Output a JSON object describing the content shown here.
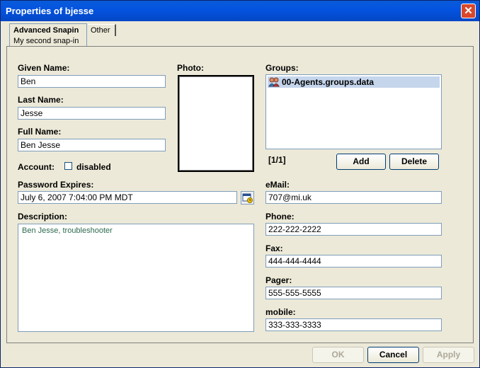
{
  "window": {
    "title": "Properties of bjesse",
    "close_glyph": "✕"
  },
  "tabs": [
    {
      "label": "Advanced Snapin",
      "sublabel": "My second snap-in"
    },
    {
      "label": "Other"
    }
  ],
  "form": {
    "given_name": {
      "label": "Given Name:",
      "value": "Ben"
    },
    "last_name": {
      "label": "Last Name:",
      "value": "Jesse"
    },
    "full_name": {
      "label": "Full Name:",
      "value": "Ben Jesse"
    },
    "account": {
      "label": "Account:",
      "checkbox_label": "disabled",
      "checked": false
    },
    "password_expires": {
      "label": "Password Expires:",
      "value": "July 6, 2007 7:04:00 PM MDT"
    },
    "description": {
      "label": "Description:",
      "value": "Ben Jesse, troubleshooter"
    },
    "photo": {
      "label": "Photo:"
    },
    "groups": {
      "label": "Groups:",
      "items": [
        "00-Agents.groups.data"
      ],
      "counter": "[1/1]"
    },
    "email": {
      "label": "eMail:",
      "value": "707@mi.uk"
    },
    "phone": {
      "label": "Phone:",
      "value": "222-222-2222"
    },
    "fax": {
      "label": "Fax:",
      "value": "444-444-4444"
    },
    "pager": {
      "label": "Pager:",
      "value": "555-555-5555"
    },
    "mobile": {
      "label": "mobile:",
      "value": "333-333-3333"
    }
  },
  "buttons": {
    "add": "Add",
    "delete": "Delete",
    "ok": "OK",
    "cancel": "Cancel",
    "apply": "Apply"
  },
  "icons": {
    "groups_item": "group-users-icon",
    "calendar": "calendar-icon"
  },
  "colors": {
    "titlebar": "#0454e0",
    "close": "#d9472b",
    "selection": "#c5d5ec",
    "description_text": "#2d6a4f"
  }
}
